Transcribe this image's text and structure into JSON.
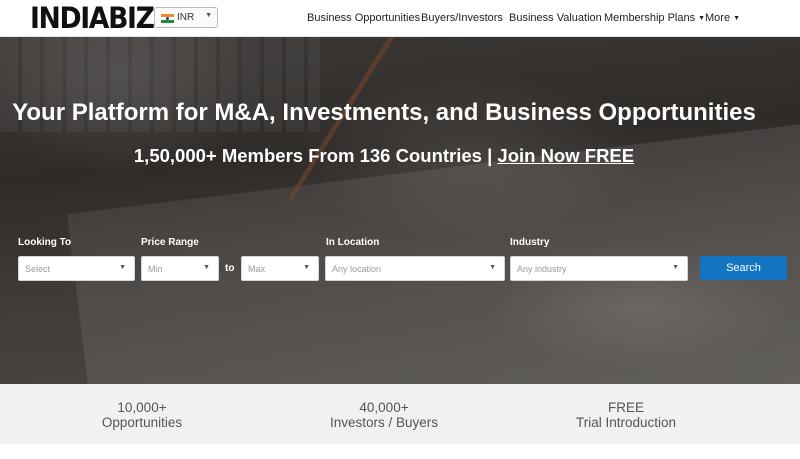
{
  "header": {
    "logo": "INDIABIZ",
    "currency": {
      "code": "INR",
      "flag": "india-flag-icon"
    },
    "nav": [
      {
        "label": "Business Opportunities",
        "dropdown": false
      },
      {
        "label": "Buyers/Investors",
        "dropdown": false
      },
      {
        "label": "Business Valuation",
        "dropdown": false
      },
      {
        "label": "Membership Plans",
        "dropdown": true
      },
      {
        "label": "More",
        "dropdown": true
      }
    ]
  },
  "hero": {
    "title": "Your Platform for M&A, Investments, and Business Opportunities",
    "subtitle_prefix": "1,50,000+ Members From 136 Countries |",
    "join_link": "Join Now FREE"
  },
  "search_form": {
    "looking_to": {
      "label": "Looking To",
      "placeholder": "Select"
    },
    "price_range": {
      "label": "Price Range",
      "min_placeholder": "Min",
      "to_text": "to",
      "max_placeholder": "Max"
    },
    "location": {
      "label": "In Location",
      "placeholder": "Any location"
    },
    "industry": {
      "label": "Industry",
      "placeholder": "Any industry"
    },
    "search_button": "Search",
    "button_color": "#1374c1"
  },
  "stats": [
    {
      "value": "10,000+",
      "label": "Opportunities"
    },
    {
      "value": "40,000+",
      "label": "Investors / Buyers"
    },
    {
      "value": "FREE",
      "label": "Trial Introduction"
    }
  ]
}
